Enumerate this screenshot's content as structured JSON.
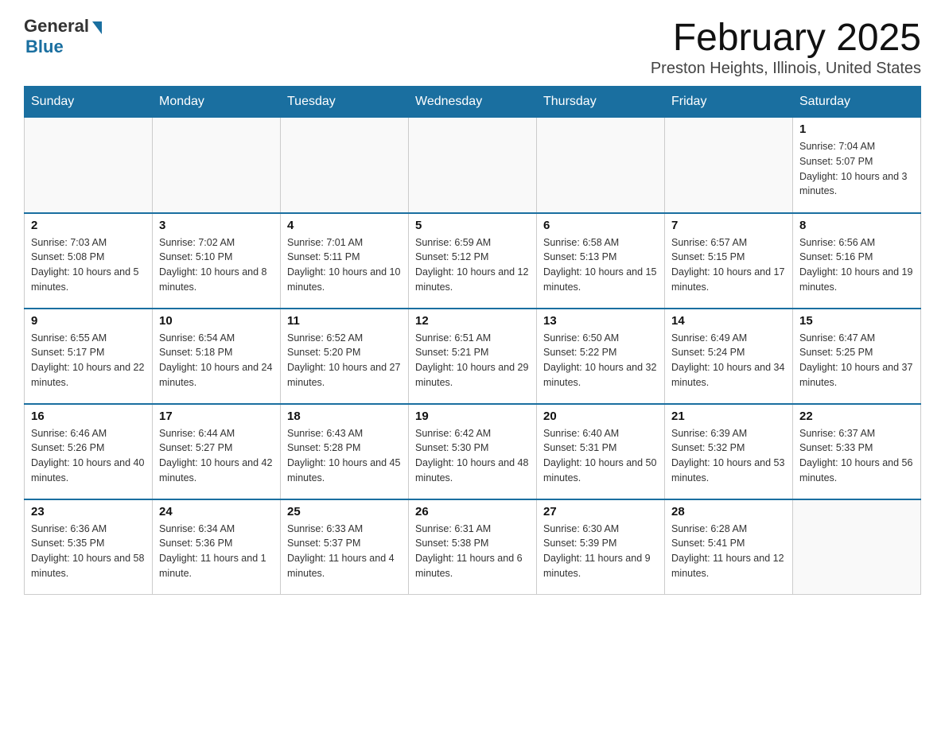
{
  "logo": {
    "general": "General",
    "blue": "Blue"
  },
  "title": "February 2025",
  "subtitle": "Preston Heights, Illinois, United States",
  "weekdays": [
    "Sunday",
    "Monday",
    "Tuesday",
    "Wednesday",
    "Thursday",
    "Friday",
    "Saturday"
  ],
  "weeks": [
    [
      {
        "day": "",
        "info": ""
      },
      {
        "day": "",
        "info": ""
      },
      {
        "day": "",
        "info": ""
      },
      {
        "day": "",
        "info": ""
      },
      {
        "day": "",
        "info": ""
      },
      {
        "day": "",
        "info": ""
      },
      {
        "day": "1",
        "info": "Sunrise: 7:04 AM\nSunset: 5:07 PM\nDaylight: 10 hours and 3 minutes."
      }
    ],
    [
      {
        "day": "2",
        "info": "Sunrise: 7:03 AM\nSunset: 5:08 PM\nDaylight: 10 hours and 5 minutes."
      },
      {
        "day": "3",
        "info": "Sunrise: 7:02 AM\nSunset: 5:10 PM\nDaylight: 10 hours and 8 minutes."
      },
      {
        "day": "4",
        "info": "Sunrise: 7:01 AM\nSunset: 5:11 PM\nDaylight: 10 hours and 10 minutes."
      },
      {
        "day": "5",
        "info": "Sunrise: 6:59 AM\nSunset: 5:12 PM\nDaylight: 10 hours and 12 minutes."
      },
      {
        "day": "6",
        "info": "Sunrise: 6:58 AM\nSunset: 5:13 PM\nDaylight: 10 hours and 15 minutes."
      },
      {
        "day": "7",
        "info": "Sunrise: 6:57 AM\nSunset: 5:15 PM\nDaylight: 10 hours and 17 minutes."
      },
      {
        "day": "8",
        "info": "Sunrise: 6:56 AM\nSunset: 5:16 PM\nDaylight: 10 hours and 19 minutes."
      }
    ],
    [
      {
        "day": "9",
        "info": "Sunrise: 6:55 AM\nSunset: 5:17 PM\nDaylight: 10 hours and 22 minutes."
      },
      {
        "day": "10",
        "info": "Sunrise: 6:54 AM\nSunset: 5:18 PM\nDaylight: 10 hours and 24 minutes."
      },
      {
        "day": "11",
        "info": "Sunrise: 6:52 AM\nSunset: 5:20 PM\nDaylight: 10 hours and 27 minutes."
      },
      {
        "day": "12",
        "info": "Sunrise: 6:51 AM\nSunset: 5:21 PM\nDaylight: 10 hours and 29 minutes."
      },
      {
        "day": "13",
        "info": "Sunrise: 6:50 AM\nSunset: 5:22 PM\nDaylight: 10 hours and 32 minutes."
      },
      {
        "day": "14",
        "info": "Sunrise: 6:49 AM\nSunset: 5:24 PM\nDaylight: 10 hours and 34 minutes."
      },
      {
        "day": "15",
        "info": "Sunrise: 6:47 AM\nSunset: 5:25 PM\nDaylight: 10 hours and 37 minutes."
      }
    ],
    [
      {
        "day": "16",
        "info": "Sunrise: 6:46 AM\nSunset: 5:26 PM\nDaylight: 10 hours and 40 minutes."
      },
      {
        "day": "17",
        "info": "Sunrise: 6:44 AM\nSunset: 5:27 PM\nDaylight: 10 hours and 42 minutes."
      },
      {
        "day": "18",
        "info": "Sunrise: 6:43 AM\nSunset: 5:28 PM\nDaylight: 10 hours and 45 minutes."
      },
      {
        "day": "19",
        "info": "Sunrise: 6:42 AM\nSunset: 5:30 PM\nDaylight: 10 hours and 48 minutes."
      },
      {
        "day": "20",
        "info": "Sunrise: 6:40 AM\nSunset: 5:31 PM\nDaylight: 10 hours and 50 minutes."
      },
      {
        "day": "21",
        "info": "Sunrise: 6:39 AM\nSunset: 5:32 PM\nDaylight: 10 hours and 53 minutes."
      },
      {
        "day": "22",
        "info": "Sunrise: 6:37 AM\nSunset: 5:33 PM\nDaylight: 10 hours and 56 minutes."
      }
    ],
    [
      {
        "day": "23",
        "info": "Sunrise: 6:36 AM\nSunset: 5:35 PM\nDaylight: 10 hours and 58 minutes."
      },
      {
        "day": "24",
        "info": "Sunrise: 6:34 AM\nSunset: 5:36 PM\nDaylight: 11 hours and 1 minute."
      },
      {
        "day": "25",
        "info": "Sunrise: 6:33 AM\nSunset: 5:37 PM\nDaylight: 11 hours and 4 minutes."
      },
      {
        "day": "26",
        "info": "Sunrise: 6:31 AM\nSunset: 5:38 PM\nDaylight: 11 hours and 6 minutes."
      },
      {
        "day": "27",
        "info": "Sunrise: 6:30 AM\nSunset: 5:39 PM\nDaylight: 11 hours and 9 minutes."
      },
      {
        "day": "28",
        "info": "Sunrise: 6:28 AM\nSunset: 5:41 PM\nDaylight: 11 hours and 12 minutes."
      },
      {
        "day": "",
        "info": ""
      }
    ]
  ]
}
